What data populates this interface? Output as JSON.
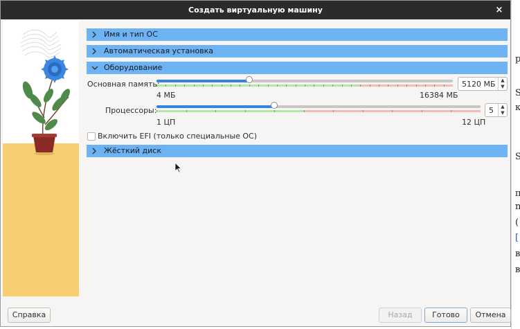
{
  "window": {
    "title": "Создать виртуальную машину",
    "close_glyph": "×"
  },
  "sections": [
    {
      "label": "Имя и тип ОС",
      "expanded": false
    },
    {
      "label": "Автоматическая установка",
      "expanded": false
    },
    {
      "label": "Оборудование",
      "expanded": true
    },
    {
      "label": "Жёсткий диск",
      "expanded": false
    }
  ],
  "hardware": {
    "memory": {
      "label": "Основная память:",
      "value": "5120 МБ",
      "min_label": "4 МБ",
      "max_label": "16384 МБ",
      "fraction": 0.312
    },
    "cpu": {
      "label": "Процессоры:",
      "value": "5",
      "min_label": "1 ЦП",
      "max_label": "12 ЦП",
      "fraction": 0.364
    },
    "efi": {
      "label": "Включить EFI (только специальные ОС)",
      "checked": false
    }
  },
  "buttons": {
    "help": "Справка",
    "back": "Назад",
    "finish": "Готово",
    "cancel": "Отмена"
  },
  "colors": {
    "section_header": "#6db2f2",
    "slider_fill": "#3584e4",
    "zone_green": "#b3e6a8",
    "zone_red": "#f4bcb4",
    "titlebar": "#2b2b2b"
  },
  "background_window_glyphs": [
    "р",
    "S",
    "к",
    "S",
    "п",
    "n",
    "(",
    "[",
    "в",
    "в"
  ]
}
